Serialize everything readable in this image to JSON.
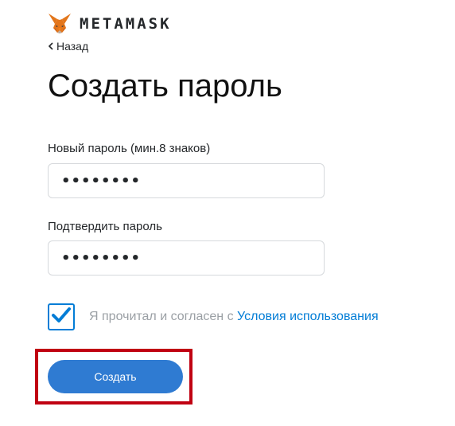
{
  "header": {
    "logo_text": "METAMASK",
    "logo_icon": "fox-icon",
    "back_label": "Назад",
    "back_icon": "chevron-left-icon"
  },
  "page_title": "Создать пароль",
  "form": {
    "new_password_label": "Новый пароль (мин.8 знаков)",
    "new_password_value": "••••••••",
    "confirm_password_label": "Подтвердить пароль",
    "confirm_password_value": "••••••••",
    "terms_checked": true,
    "terms_prefix": "Я прочитал и согласен с ",
    "terms_link": "Условия использования",
    "submit_label": "Создать"
  },
  "colors": {
    "accent": "#037dd6",
    "button": "#2f7bd2",
    "highlight": "#c00012",
    "muted_text": "#9ba0a5"
  }
}
